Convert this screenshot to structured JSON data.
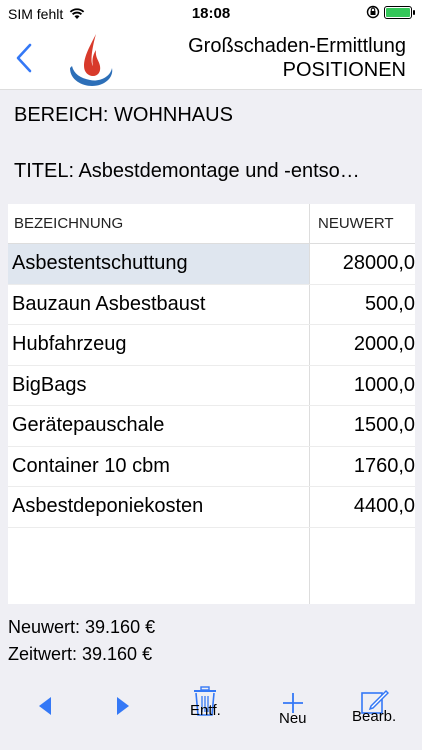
{
  "status": {
    "carrier": "SIM fehlt",
    "time": "18:08"
  },
  "nav": {
    "title_line1": "Großschaden-Ermittlung",
    "title_line2": "POSITIONEN"
  },
  "bereich": "BEREICH: WOHNHAUS",
  "titel": "TITEL: Asbestdemontage und -entso…",
  "table": {
    "headers": [
      "BEZEICHNUNG",
      "NEUWERT"
    ],
    "rows": [
      {
        "name": "Asbestentschuttung",
        "value": "28000,0"
      },
      {
        "name": "Bauzaun Asbestbaust",
        "value": "500,0"
      },
      {
        "name": "Hubfahrzeug",
        "value": "2000,0"
      },
      {
        "name": "BigBags",
        "value": "1000,0"
      },
      {
        "name": "Gerätepauschale",
        "value": "1500,0"
      },
      {
        "name": "Container 10 cbm",
        "value": "1760,0"
      },
      {
        "name": "Asbestdeponiekosten",
        "value": "4400,0"
      }
    ]
  },
  "totals": {
    "neuwert": "Neuwert: 39.160 €",
    "zeitwert": "Zeitwert: 39.160 €"
  },
  "toolbar": {
    "delete_label": "Entf.",
    "new_label": "Neu",
    "edit_label": "Bearb."
  },
  "colors": {
    "accent": "#3478f6",
    "selected_row": "#dfe6ef",
    "battery": "#34c759"
  }
}
